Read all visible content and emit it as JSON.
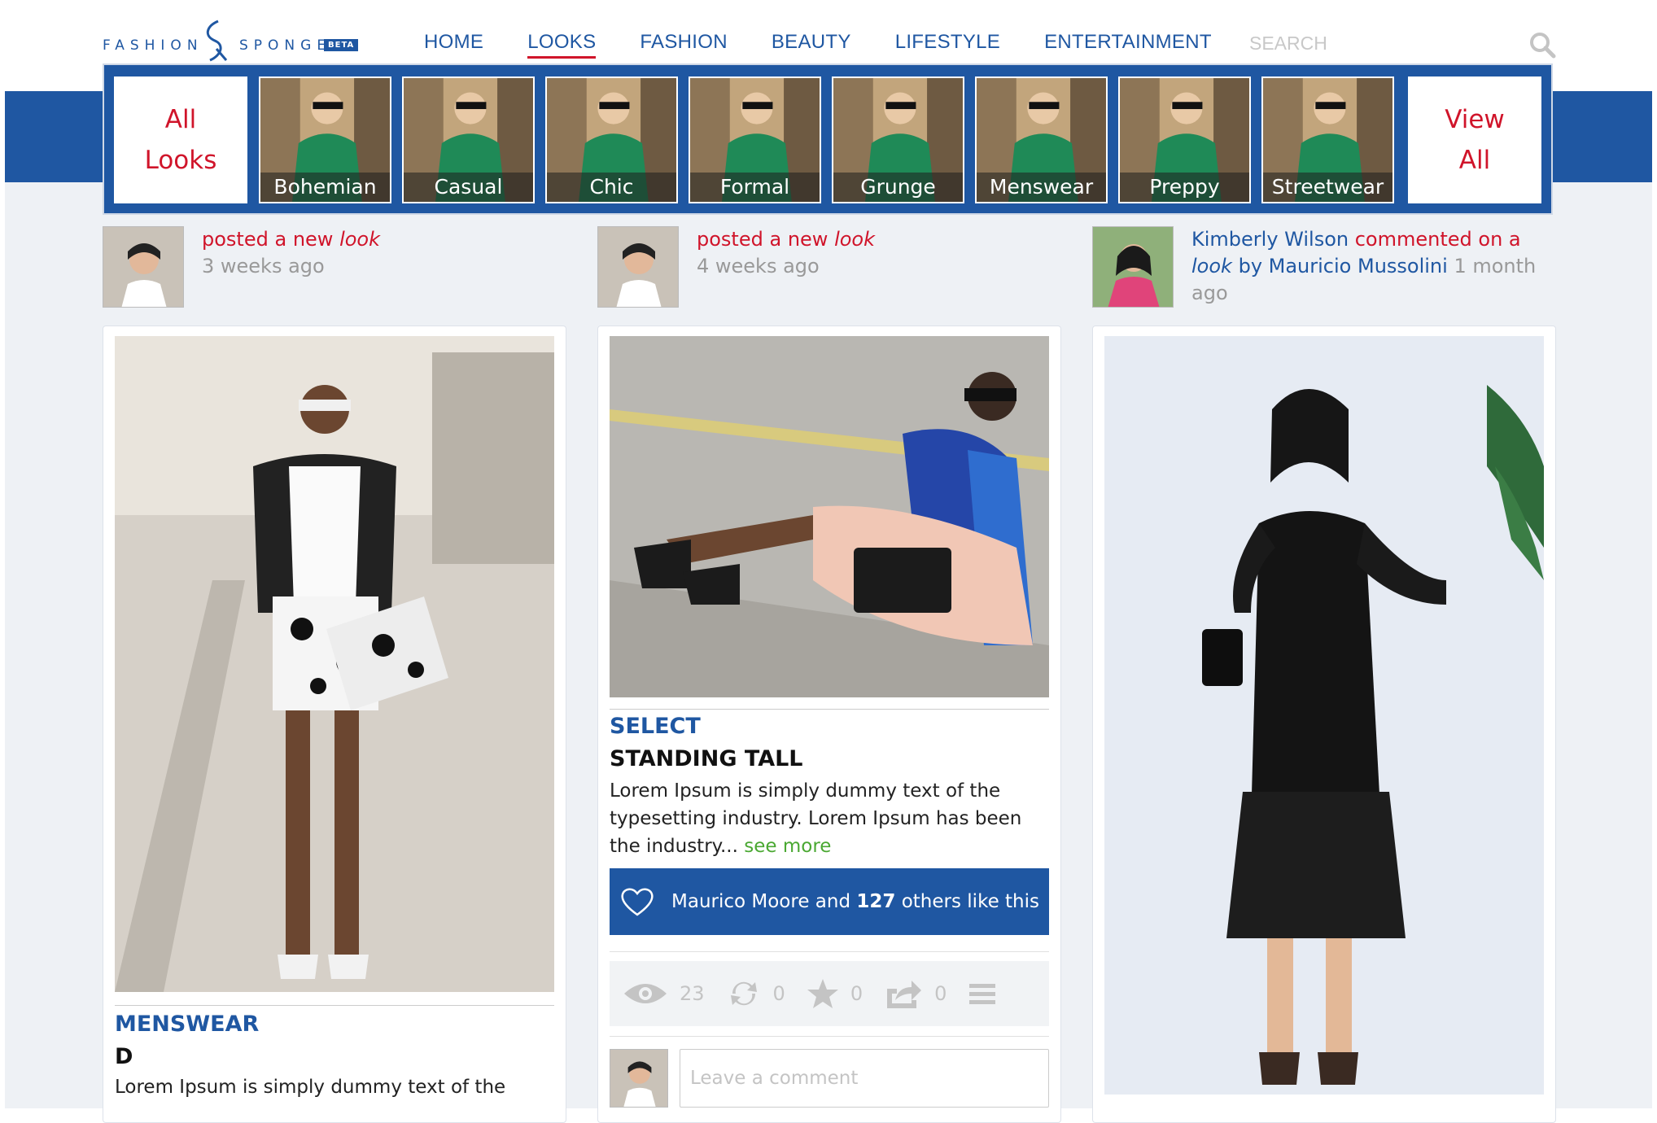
{
  "brand": {
    "word1": "FASHION",
    "word2": "SPONGE",
    "badge": "BETA"
  },
  "nav": {
    "items": [
      "HOME",
      "LOOKS",
      "FASHION",
      "BEAUTY",
      "LIFESTYLE",
      "ENTERTAINMENT"
    ],
    "active": "LOOKS"
  },
  "search": {
    "placeholder": "SEARCH"
  },
  "looks_menu": {
    "all_label": "All\nLooks",
    "view_all_label": "View\nAll",
    "categories": [
      "Bohemian",
      "Casual",
      "Chic",
      "Formal",
      "Grunge",
      "Menswear",
      "Preppy",
      "Streetwear"
    ]
  },
  "activity": [
    {
      "verb": "posted",
      "mid": "a new",
      "obj": "look",
      "time": "3 weeks ago"
    },
    {
      "verb": "posted",
      "mid": "a new",
      "obj": "look",
      "time": "4 weeks ago"
    },
    {
      "actor": "Kimberly Wilson",
      "verb": "commented",
      "mid": "on a",
      "obj": "look",
      "by_label": "by Mauricio Mussolini",
      "time": "1 month ago"
    }
  ],
  "cards": [
    {
      "category": "MENSWEAR",
      "title": "D",
      "body": "Lorem Ipsum is simply dummy text of the"
    },
    {
      "category": "SELECT",
      "title": "STANDING TALL",
      "body": "Lorem Ipsum is simply dummy text of the typesetting industry. Lorem Ipsum has been the industry...",
      "see_more": "see more",
      "likes": {
        "name": "Maurico Moore",
        "and": "and",
        "count": "127",
        "suffix": "others like this"
      },
      "stats": {
        "views": "23",
        "reposts": "0",
        "favorites": "0",
        "shares": "0"
      },
      "comment_placeholder": "Leave a comment"
    },
    {}
  ],
  "colors": {
    "brand_blue": "#1f57a2",
    "accent_red": "#d0142a",
    "link_green": "#4aa832"
  }
}
